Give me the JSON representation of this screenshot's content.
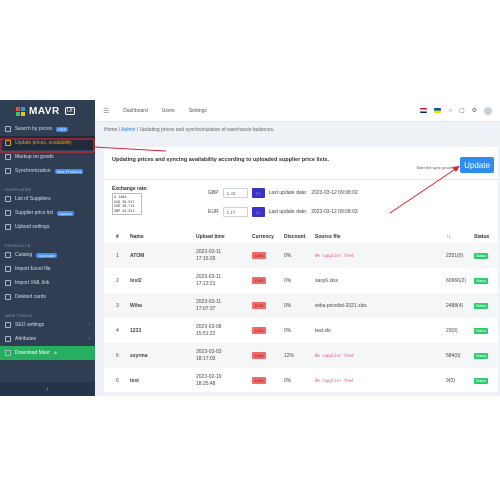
{
  "sidebar": {
    "logo": "MAVR",
    "logo_badge": "UI",
    "items_main": [
      {
        "label": "Search by prices",
        "badge": "PRF",
        "active": false
      },
      {
        "label": "Update prices, availability",
        "active": true
      },
      {
        "label": "Markup on goods",
        "active": false
      },
      {
        "label": "Synchronization",
        "badge": "New Products",
        "active": false
      }
    ],
    "section_suppliers": "SUPPLIERS",
    "items_suppliers": [
      {
        "label": "List of Suppliers"
      },
      {
        "label": "Supplier price list",
        "badge": "Upload"
      },
      {
        "label": "Upload settings"
      }
    ],
    "section_products": "PRODUCTS",
    "items_products": [
      {
        "label": "Catalog",
        "badge": "Opencart"
      },
      {
        "label": "Import Excel file"
      },
      {
        "label": "Import XML link"
      },
      {
        "label": "Deleted cards"
      }
    ],
    "section_web": "WEB TOOLS",
    "items_web": [
      {
        "label": "SEO settings"
      },
      {
        "label": "Attributes"
      },
      {
        "label": "Download Mavr",
        "sup": "UI"
      }
    ],
    "collapse": "‹"
  },
  "topbar": {
    "menu": "☰",
    "links": [
      "Dashboard",
      "Users",
      "Settings"
    ]
  },
  "breadcrumb": {
    "home": "Home",
    "sep": "/",
    "admin": "Admin",
    "current": "Updating prices and synchronization of warehouse balances."
  },
  "card": {
    "title": "Updating prices and syncing availability according to uploaded supplier price lists.",
    "sync_label": "Start the sync process",
    "update_button": "Update"
  },
  "exchange": {
    "title": "Exchange rate:",
    "box_lines": [
      "$ 1404",
      "USD 36.917",
      "EUR 38.713",
      "GBP 44.321"
    ],
    "rates": [
      {
        "currency": "GBP",
        "value": "1.43",
        "button": "↑↓",
        "date_label": "Last update date:",
        "date": "2023-03-12 09:08:02"
      },
      {
        "currency": "EUR",
        "value": "1.17",
        "button": "↑↓",
        "date_label": "Last update date:",
        "date": "2023-03-12 09:08:03"
      }
    ]
  },
  "table": {
    "headers": [
      "#",
      "Name",
      "Upload time",
      "Currency",
      "Discount",
      "Source file",
      "↑↓",
      "Status"
    ],
    "rows": [
      {
        "num": "1",
        "name": "ATOM",
        "date": "2023-03-11",
        "time": "17:15:26",
        "currency": "UAH",
        "discount": "0%",
        "source": "0% supplier feed",
        "feed": true,
        "count": "2251(0)",
        "status": "Status"
      },
      {
        "num": "2",
        "name": "test2",
        "date": "2023-03-11",
        "time": "17:12:21",
        "currency": "EUR",
        "discount": "0%",
        "source": "sasy6.xlsx",
        "feed": false,
        "count": "60966(2)",
        "status": "Status"
      },
      {
        "num": "3",
        "name": "Wiha",
        "date": "2023-03-11",
        "time": "17:07:37",
        "currency": "EUR",
        "discount": "0%",
        "source": "wiha-pricelist-2021.xlsx",
        "feed": false,
        "count": "2488(4)",
        "status": "Status"
      },
      {
        "num": "4",
        "name": "1233",
        "date": "2023-03-08",
        "time": "15:51:22",
        "currency": "USD",
        "discount": "0%",
        "source": "test.xls",
        "feed": false,
        "count": "23(0)",
        "status": "Status"
      },
      {
        "num": "5",
        "name": "ssyrma",
        "date": "2023-03-03",
        "time": "18:17:03",
        "currency": "UAH",
        "discount": "12%",
        "source": "0% supplier feed",
        "feed": true,
        "count": "584(0)",
        "status": "Status"
      },
      {
        "num": "6",
        "name": "test",
        "date": "2023-02-19",
        "time": "18:25:48",
        "currency": "UAH",
        "discount": "0%",
        "source": "0% supplier feed",
        "feed": true,
        "count": "9(0)",
        "status": "Status"
      }
    ]
  },
  "colors": {
    "sidebar": "#2f3e53",
    "accent": "#2d8ef0",
    "status": "#2ecc71",
    "annotation": "#d9232e"
  }
}
